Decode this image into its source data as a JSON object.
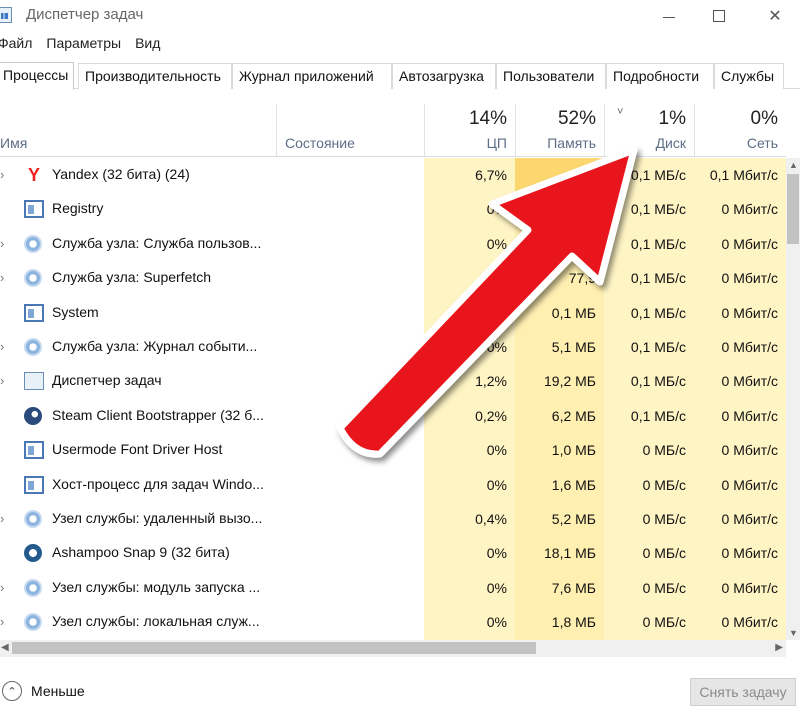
{
  "window": {
    "title": "Диспетчер задач",
    "controls": {
      "minimize": "—",
      "maximize": "☐",
      "close": "✕"
    }
  },
  "menu": [
    "Файл",
    "Параметры",
    "Вид"
  ],
  "tabs": [
    {
      "label": "Процессы",
      "active": true
    },
    {
      "label": "Производительность",
      "active": false
    },
    {
      "label": "Журнал приложений",
      "active": false
    },
    {
      "label": "Автозагрузка",
      "active": false
    },
    {
      "label": "Пользователи",
      "active": false
    },
    {
      "label": "Подробности",
      "active": false
    },
    {
      "label": "Службы",
      "active": false
    }
  ],
  "columns": {
    "name": "Имя",
    "state": "Состояние",
    "cpu": {
      "pct": "14%",
      "label": "ЦП"
    },
    "memory": {
      "pct": "52%",
      "label": "Память"
    },
    "disk": {
      "pct": "1%",
      "label": "Диск"
    },
    "network": {
      "pct": "0%",
      "label": "Сеть"
    },
    "sort_indicator": "˅"
  },
  "processes": [
    {
      "expand": "›",
      "icon": "yandex-icon",
      "name": "Yandex (32 бита) (24)",
      "cpu": "6,7%",
      "memory": "",
      "disk": "0,1 МБ/с",
      "network": "0,1 Мбит/с"
    },
    {
      "expand": "",
      "icon": "window-icon",
      "name": "Registry",
      "cpu": "0%",
      "memory": "",
      "disk": "0,1 МБ/с",
      "network": "0 Мбит/с"
    },
    {
      "expand": "›",
      "icon": "gear-icon",
      "name": "Служба узла: Служба пользов...",
      "cpu": "0%",
      "memory": "2,3",
      "disk": "0,1 МБ/с",
      "network": "0 Мбит/с"
    },
    {
      "expand": "›",
      "icon": "gear-icon",
      "name": "Служба узла: Superfetch",
      "cpu": "",
      "memory": "77,9",
      "disk": "0,1 МБ/с",
      "network": "0 Мбит/с"
    },
    {
      "expand": "",
      "icon": "window-icon",
      "name": "System",
      "cpu": "0,8%",
      "memory": "0,1 МБ",
      "disk": "0,1 МБ/с",
      "network": "0 Мбит/с"
    },
    {
      "expand": "›",
      "icon": "gear-icon",
      "name": "Служба узла: Журнал событи...",
      "cpu": "0%",
      "memory": "5,1 МБ",
      "disk": "0,1 МБ/с",
      "network": "0 Мбит/с"
    },
    {
      "expand": "›",
      "icon": "taskmgr-icon",
      "name": "Диспетчер задач",
      "cpu": "1,2%",
      "memory": "19,2 МБ",
      "disk": "0,1 МБ/с",
      "network": "0 Мбит/с"
    },
    {
      "expand": "",
      "icon": "steam-icon",
      "name": "Steam Client Bootstrapper (32 б...",
      "cpu": "0,2%",
      "memory": "6,2 МБ",
      "disk": "0,1 МБ/с",
      "network": "0 Мбит/с"
    },
    {
      "expand": "",
      "icon": "window-icon",
      "name": "Usermode Font Driver Host",
      "cpu": "0%",
      "memory": "1,0 МБ",
      "disk": "0 МБ/с",
      "network": "0 Мбит/с"
    },
    {
      "expand": "",
      "icon": "window-icon",
      "name": "Хост-процесс для задач Windo...",
      "cpu": "0%",
      "memory": "1,6 МБ",
      "disk": "0 МБ/с",
      "network": "0 Мбит/с"
    },
    {
      "expand": "›",
      "icon": "gear-icon",
      "name": "Узел службы: удаленный вызо...",
      "cpu": "0,4%",
      "memory": "5,2 МБ",
      "disk": "0 МБ/с",
      "network": "0 Мбит/с"
    },
    {
      "expand": "",
      "icon": "ashampoo-icon",
      "name": "Ashampoo Snap 9 (32 бита)",
      "cpu": "0%",
      "memory": "18,1 МБ",
      "disk": "0 МБ/с",
      "network": "0 Мбит/с"
    },
    {
      "expand": "›",
      "icon": "gear-icon",
      "name": "Узел службы: модуль запуска ...",
      "cpu": "0%",
      "memory": "7,6 МБ",
      "disk": "0 МБ/с",
      "network": "0 Мбит/с"
    },
    {
      "expand": "›",
      "icon": "gear-icon",
      "name": "Узел службы: локальная служ...",
      "cpu": "0%",
      "memory": "1,8 МБ",
      "disk": "0 МБ/с",
      "network": "0 Мбит/с"
    }
  ],
  "footer": {
    "less_label": "Меньше",
    "less_icon": "⌃",
    "end_task_label": "Снять задачу"
  },
  "scroll": {
    "up": "▲",
    "down": "▼",
    "left": "◀",
    "right": "▶"
  },
  "colors": {
    "heat_light": "#fff4c4",
    "heat_medium": "#ffefb0",
    "heat_hot": "#fcd770",
    "header_label": "#5d6e86",
    "arrow_red": "#e8141b"
  }
}
